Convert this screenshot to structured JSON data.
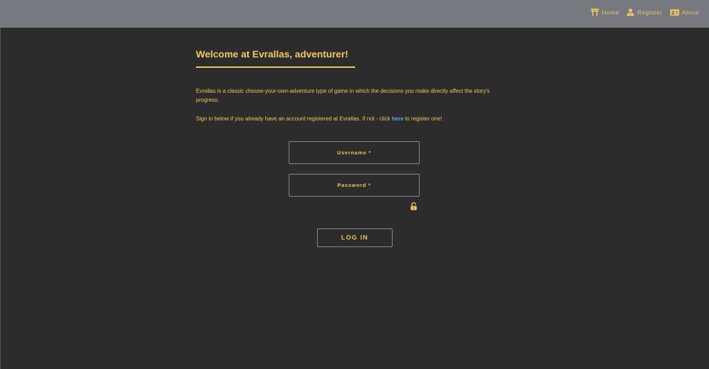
{
  "nav": {
    "items": [
      {
        "label": "Home",
        "icon": "torii-gate-icon"
      },
      {
        "label": "Register",
        "icon": "user-tie-icon"
      },
      {
        "label": "About",
        "icon": "id-card-icon"
      }
    ]
  },
  "main": {
    "title": "Welcome at Evrallas, adventurer!",
    "intro": "Evrallas is a classic choose-your-own-adventure type of game in which the decisions you make directly affect the story's progress.",
    "signin_prefix": "Sign in below if you already have an account registered at Evrallas. If not - click ",
    "signin_link": "here",
    "signin_suffix": " to register one!"
  },
  "form": {
    "username_label": "Username *",
    "password_label": "Password *",
    "password_toggle_icon": "lock-open-icon",
    "login_label": "LOG IN"
  },
  "colors": {
    "accent": "#f3c460",
    "link": "#5aa9ff",
    "topbar": "#767980",
    "background": "#2c2c2c"
  }
}
